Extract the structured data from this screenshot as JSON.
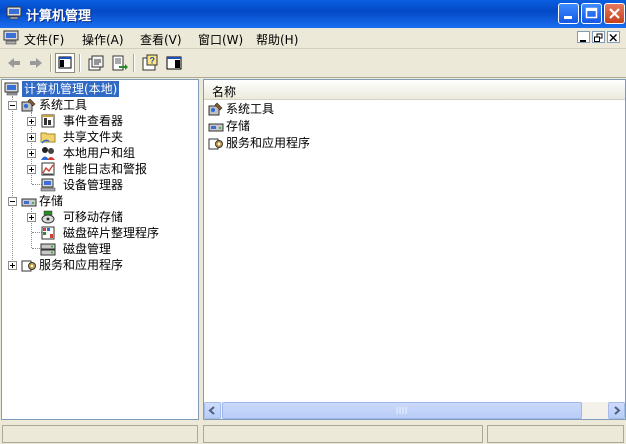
{
  "window": {
    "title": "计算机管理"
  },
  "menu": [
    {
      "label": "文件(F)"
    },
    {
      "label": "操作(A)"
    },
    {
      "label": "查看(V)"
    },
    {
      "label": "窗口(W)"
    },
    {
      "label": "帮助(H)"
    }
  ],
  "toolbar": {
    "buttons": [
      "back-arrow-icon",
      "forward-arrow-icon",
      "show-hide-tree-icon",
      "properties-icon",
      "export-list-icon",
      "help-icon",
      "action-pane-icon"
    ]
  },
  "tree": {
    "root": "计算机管理(本地)",
    "items": [
      {
        "label": "系统工具"
      },
      {
        "label": "事件查看器"
      },
      {
        "label": "共享文件夹"
      },
      {
        "label": "本地用户和组"
      },
      {
        "label": "性能日志和警报"
      },
      {
        "label": "设备管理器"
      },
      {
        "label": "存储"
      },
      {
        "label": "可移动存储"
      },
      {
        "label": "磁盘碎片整理程序"
      },
      {
        "label": "磁盘管理"
      },
      {
        "label": "服务和应用程序"
      }
    ]
  },
  "list": {
    "column_header": "名称",
    "items": [
      {
        "label": "系统工具"
      },
      {
        "label": "存储"
      },
      {
        "label": "服务和应用程序"
      }
    ]
  },
  "colors": {
    "titlebar": "#0a5fe0",
    "selection": "#316ac5",
    "chrome": "#ece9d8"
  }
}
